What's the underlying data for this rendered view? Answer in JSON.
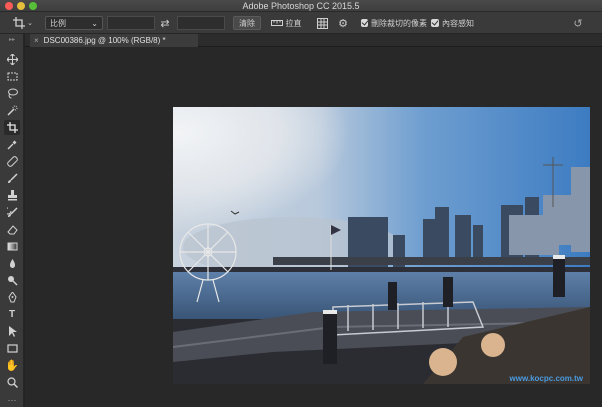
{
  "window": {
    "title": "Adobe Photoshop CC 2015.5"
  },
  "options_bar": {
    "ratio_select": "比例",
    "ratio_chevron": "⌄",
    "swap_icon": "⇄",
    "clear_label": "清除",
    "straighten_label": "拉直",
    "delete_cropped_label": "刪除裁切的像素",
    "content_aware_label": "內容感知"
  },
  "document": {
    "tab_close": "×",
    "tab_title": "DSC00386.jpg @ 100% (RGB/8) *"
  },
  "photo": {
    "watermark": "www.kocpc.com.tw"
  },
  "tools": [
    "move-tool-icon",
    "marquee-tool-icon",
    "lasso-tool-icon",
    "quick-select-tool-icon",
    "crop-tool-icon",
    "eyedropper-tool-icon",
    "healing-brush-tool-icon",
    "brush-tool-icon",
    "clone-stamp-tool-icon",
    "history-brush-tool-icon",
    "eraser-tool-icon",
    "gradient-tool-icon",
    "blur-tool-icon",
    "dodge-tool-icon",
    "pen-tool-icon",
    "type-tool-icon",
    "path-select-tool-icon",
    "rectangle-tool-icon",
    "hand-tool-icon",
    "zoom-tool-icon"
  ]
}
